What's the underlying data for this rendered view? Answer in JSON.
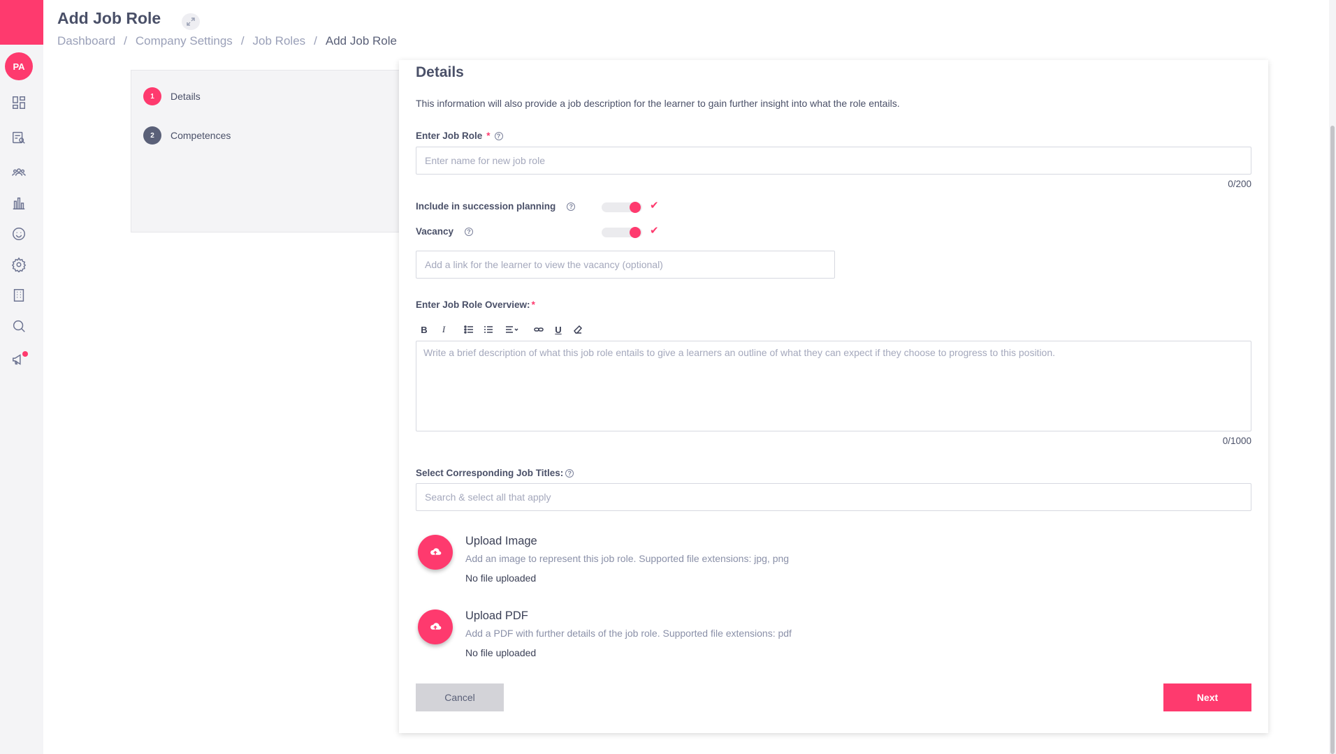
{
  "sidebar": {
    "avatar_initials": "PA",
    "icons": [
      "dashboard-icon",
      "search-report-icon",
      "people-icon",
      "chart-icon",
      "smile-icon",
      "gear-icon",
      "building-icon",
      "search-icon",
      "megaphone-icon"
    ],
    "accent": "#fe3a6e"
  },
  "header": {
    "title": "Add Job Role",
    "breadcrumb": [
      "Dashboard",
      "Company Settings",
      "Job Roles",
      "Add Job Role"
    ]
  },
  "steps": [
    {
      "num": "1",
      "label": "Details",
      "color": "#fe3a6e"
    },
    {
      "num": "2",
      "label": "Competences",
      "color": "#5a6078"
    }
  ],
  "details": {
    "heading": "Details",
    "description": "This information will also provide a job description for the learner to gain further insight into what the role entails.",
    "job_role_label": "Enter Job Role",
    "job_role_placeholder": "Enter name for new job role",
    "job_role_counter": "0/200",
    "succession_label": "Include in succession planning",
    "vacancy_label": "Vacancy",
    "vacancy_link_placeholder": "Add a link for the learner to view the vacancy (optional)",
    "overview_label": "Enter Job Role Overview:",
    "overview_placeholder": "Write a brief description of what this job role entails to give a learners an outline of what they can expect if they choose to progress to this position.",
    "overview_counter": "0/1000",
    "job_titles_label": "Select Corresponding Job Titles:",
    "job_titles_placeholder": "Search & select all that apply",
    "toggles": {
      "succession": true,
      "vacancy": true
    }
  },
  "uploads": {
    "image": {
      "title": "Upload Image",
      "desc": "Add an image to represent this job role. Supported file extensions: jpg, png",
      "status": "No file uploaded"
    },
    "pdf": {
      "title": "Upload PDF",
      "desc": "Add a PDF with further details of the job role. Supported file extensions: pdf",
      "status": "No file uploaded"
    }
  },
  "actions": {
    "cancel": "Cancel",
    "next": "Next"
  },
  "toolbar": {
    "bold": "B",
    "italic": "I",
    "underline": "U"
  },
  "symbols": {
    "required": "*",
    "help": "?",
    "check": "✔",
    "separator": "/"
  }
}
